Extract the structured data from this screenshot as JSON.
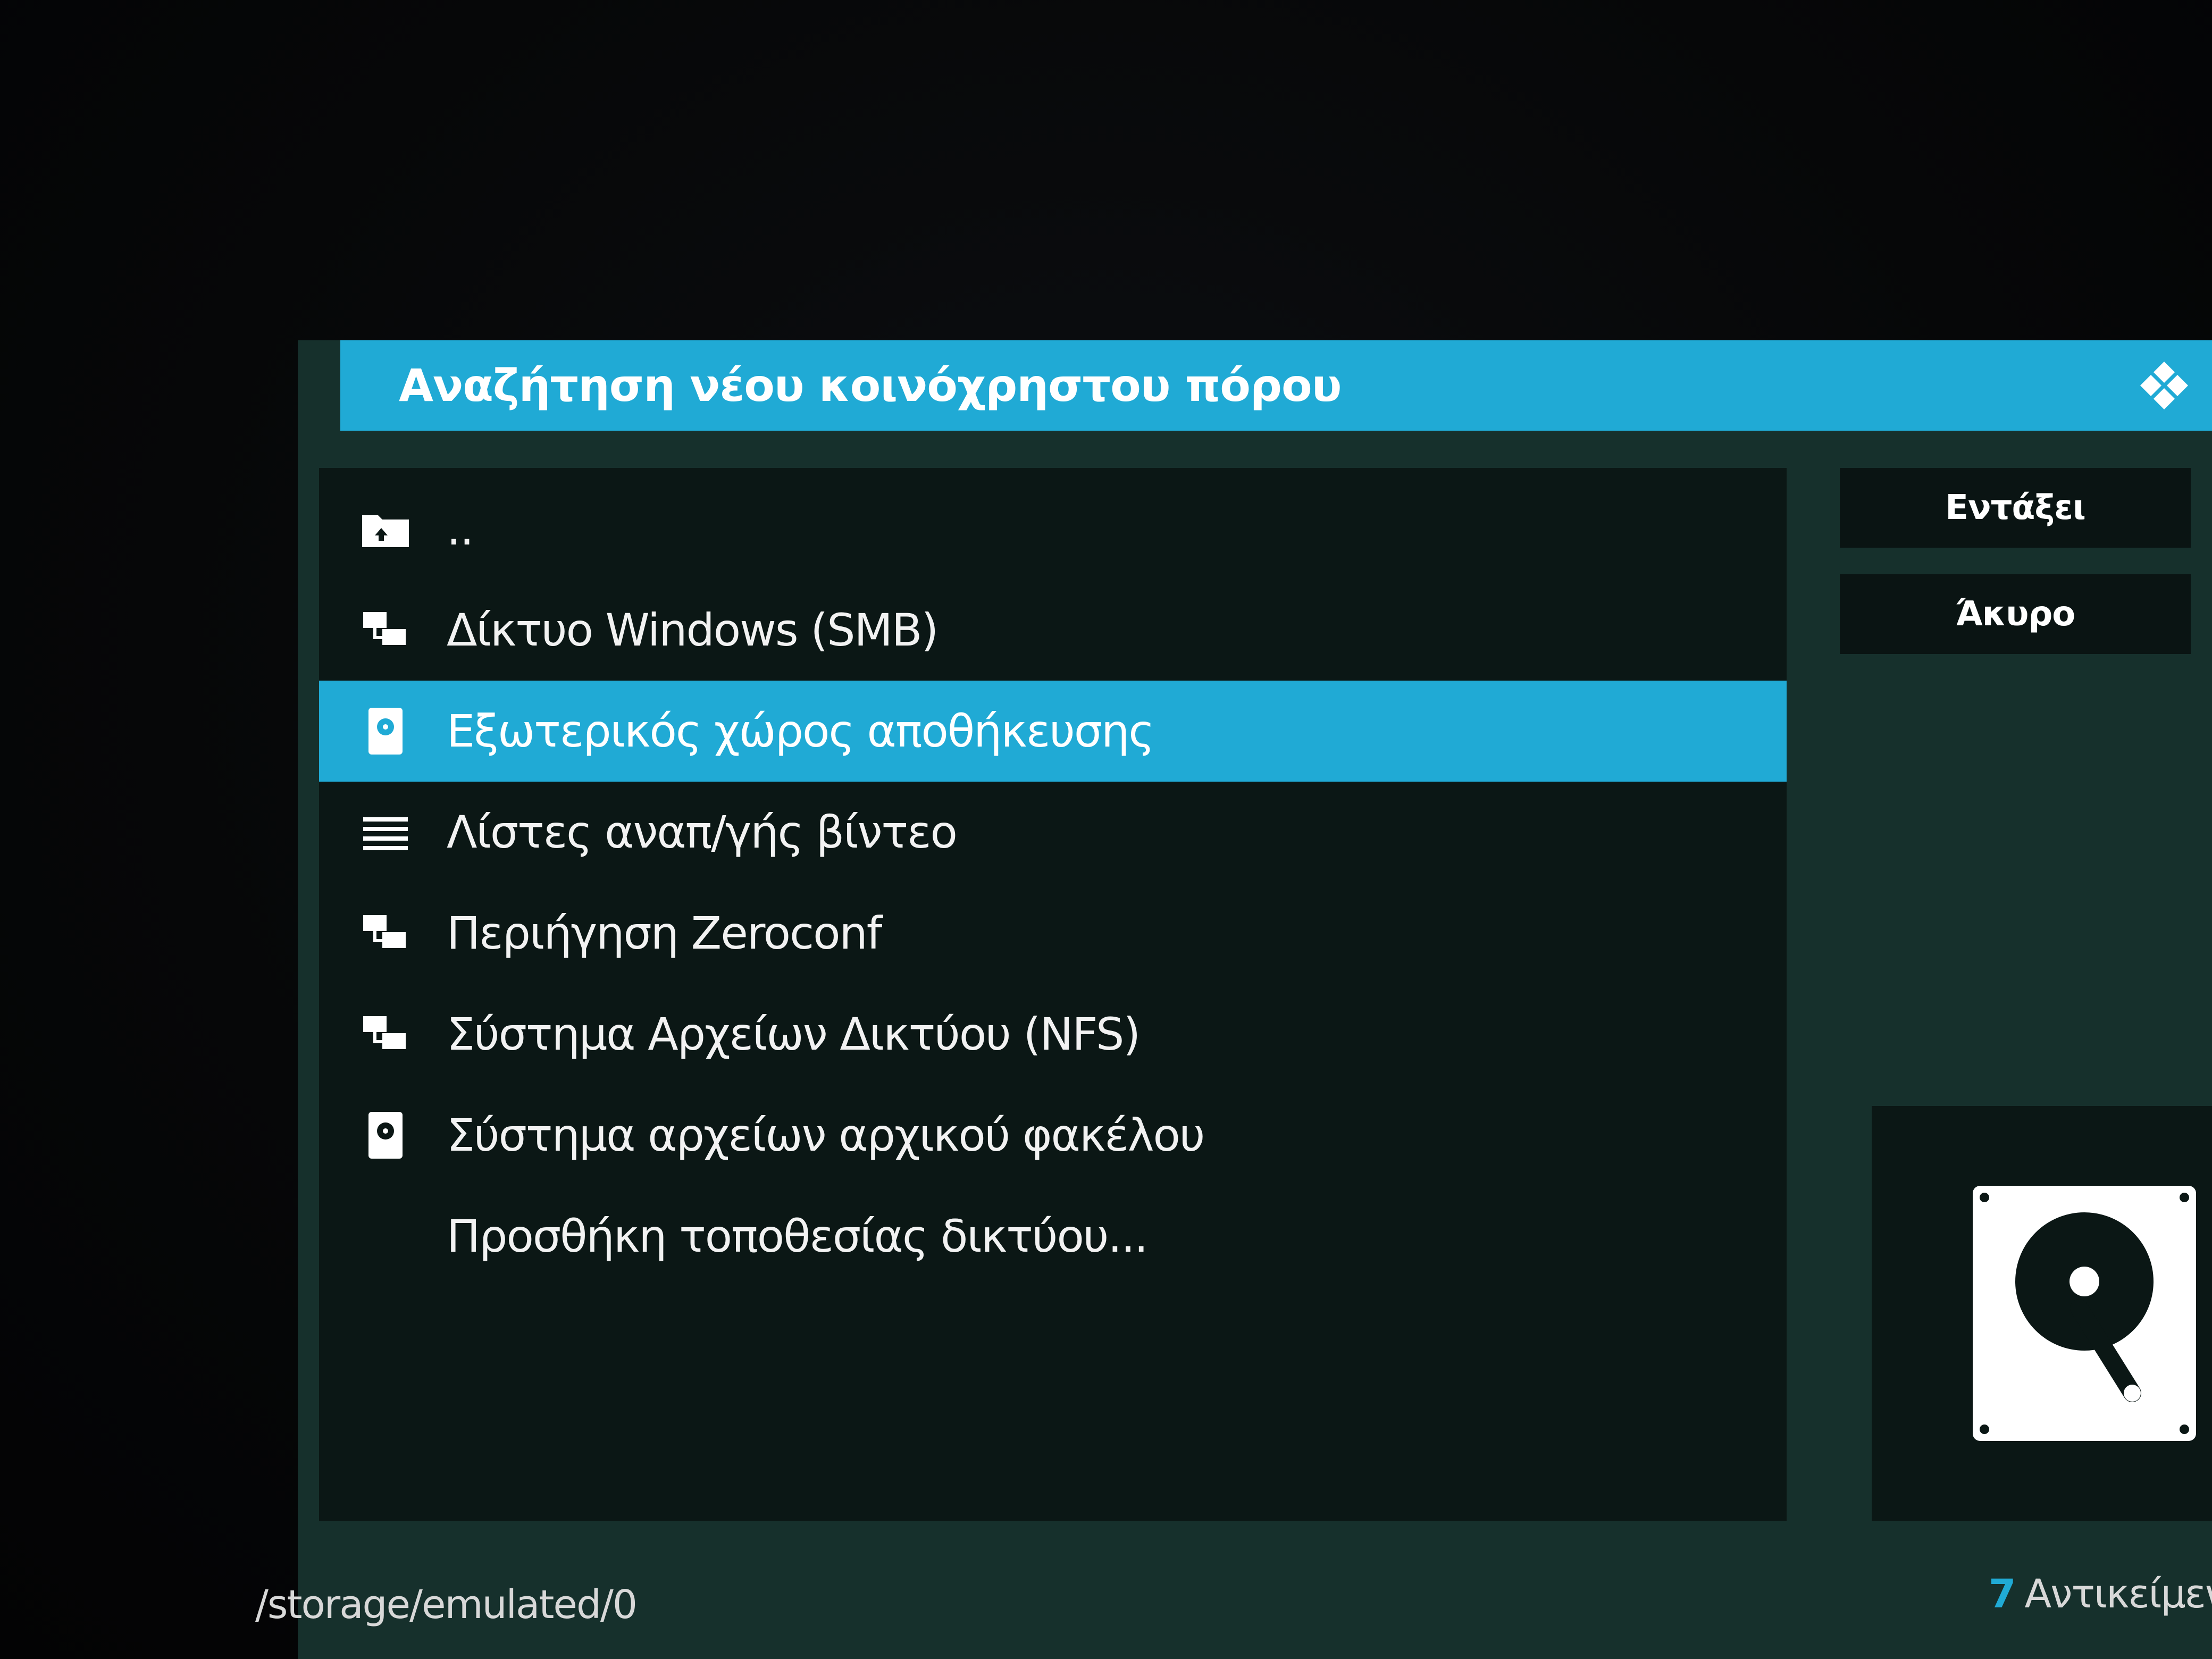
{
  "dialog": {
    "title": "Αναζήτηση νέου κοινόχρηστου πόρου"
  },
  "list": {
    "items": [
      {
        "label": "..",
        "icon": "folder-up-icon",
        "selected": false
      },
      {
        "label": "Δίκτυο Windows (SMB)",
        "icon": "network-icon",
        "selected": false
      },
      {
        "label": "Εξωτερικός χώρος αποθήκευσης",
        "icon": "removable-drive-icon",
        "selected": true
      },
      {
        "label": "Λίστες αναπ/γής βίντεο",
        "icon": "playlist-icon",
        "selected": false
      },
      {
        "label": "Περιήγηση Zeroconf",
        "icon": "network-icon",
        "selected": false
      },
      {
        "label": "Σύστημα Αρχείων Δικτύου (NFS)",
        "icon": "network-icon",
        "selected": false
      },
      {
        "label": "Σύστημα αρχείων αρχικού φακέλου",
        "icon": "hard-drive-icon",
        "selected": false
      },
      {
        "label": "Προσθήκη τοποθεσίας δικτύου...",
        "icon": "",
        "selected": false
      }
    ]
  },
  "buttons": {
    "ok_label": "Εντάξει",
    "cancel_label": "Άκυρο"
  },
  "footer": {
    "path": "/storage/emulated/0",
    "count": "7",
    "count_label": "Αντικείμενα"
  },
  "colors": {
    "accent": "#20aad5",
    "dialog_bg": "#16302c",
    "panel_bg": "#0b1715"
  }
}
